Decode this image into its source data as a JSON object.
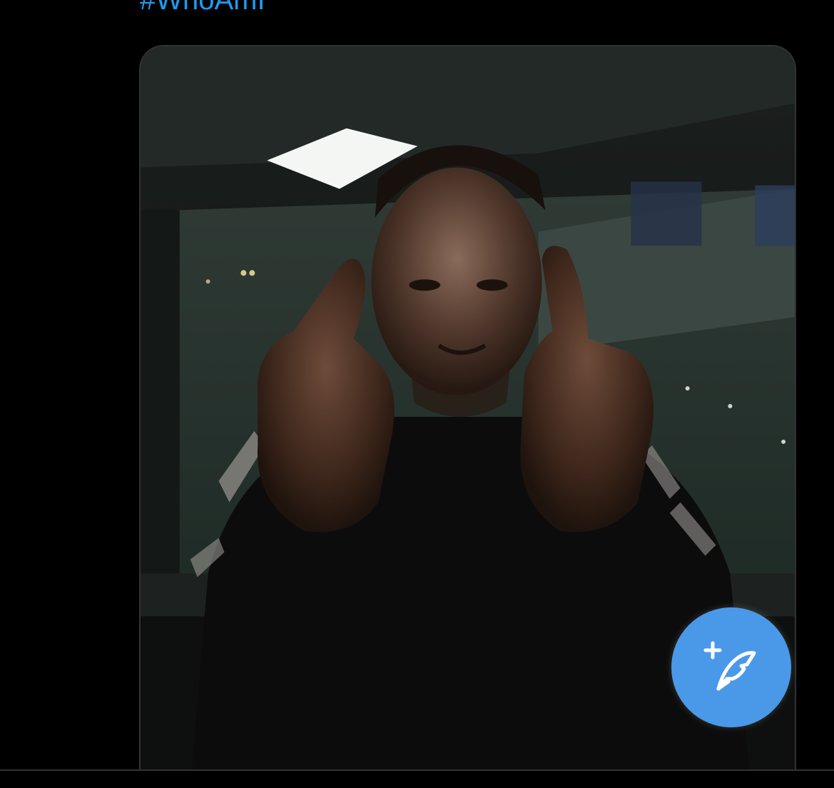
{
  "tweet": {
    "hashtag": "#WhoAmI"
  },
  "media": {
    "kind": "video-thumbnail"
  },
  "fab": {
    "icon": "compose-tweet-icon",
    "color": "#4a99e9"
  },
  "colors": {
    "background": "#000000",
    "link": "#1d9bf0",
    "border": "#2f3336"
  }
}
